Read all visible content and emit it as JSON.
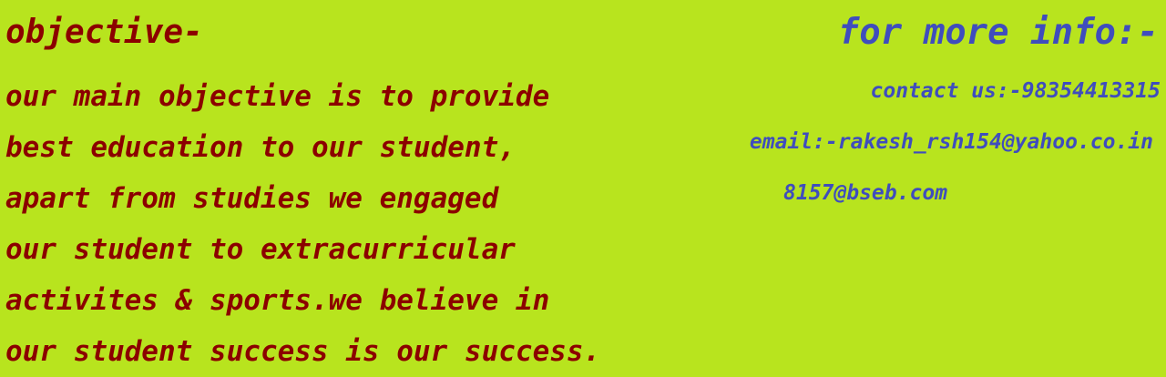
{
  "colors": {
    "background": "#b8e41e",
    "objective_text": "#8b0000",
    "info_text": "#3f4dbd"
  },
  "objective": {
    "title": "objective-",
    "lines": [
      "our main objective is to provide",
      "best education to our student,",
      "apart from studies we engaged",
      "our student to extracurricular",
      "activites & sports.we believe in",
      "our student success is our success."
    ]
  },
  "info": {
    "title": "for more info:-",
    "contact": "contact us:-98354413315",
    "email": "email:-rakesh_rsh154@yahoo.co.in",
    "email_secondary": "8157@bseb.com"
  }
}
